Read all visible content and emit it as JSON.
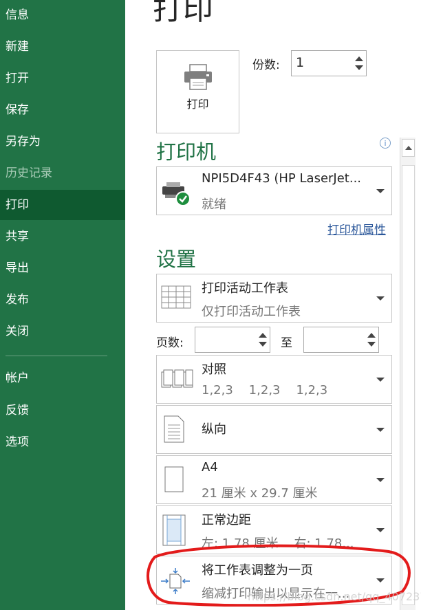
{
  "sidebar": {
    "items": [
      {
        "label": "信息"
      },
      {
        "label": "新建"
      },
      {
        "label": "打开"
      },
      {
        "label": "保存"
      },
      {
        "label": "另存为"
      },
      {
        "label": "历史记录"
      },
      {
        "label": "打印"
      },
      {
        "label": "共享"
      },
      {
        "label": "导出"
      },
      {
        "label": "发布"
      },
      {
        "label": "关闭"
      },
      {
        "label": "帐户"
      },
      {
        "label": "反馈"
      },
      {
        "label": "选项"
      }
    ],
    "active": "打印",
    "disabled": "历史记录"
  },
  "main": {
    "title": "打印",
    "print_button": {
      "label": "打印"
    },
    "copies": {
      "label": "份数:",
      "value": "1"
    },
    "printer_section": "打印机",
    "printer": {
      "name": "NPI5D4F43 (HP LaserJet...",
      "status": "就绪"
    },
    "printer_properties_link": "打印机属性",
    "settings_section": "设置",
    "settings": [
      {
        "title": "打印活动工作表",
        "subtitle": "仅打印活动工作表",
        "icon": "sheet-grid-icon"
      },
      {
        "title": "对照",
        "subtitle": "1,2,3    1,2,3    1,2,3",
        "icon": "collate-icon"
      },
      {
        "title": "纵向",
        "subtitle": "",
        "icon": "portrait-icon"
      },
      {
        "title": "A4",
        "subtitle": "21 厘米 x 29.7 厘米",
        "icon": "paper-size-icon"
      },
      {
        "title": "正常边距",
        "subtitle": "左: 1.78 厘米    右: 1.78...",
        "icon": "margins-icon"
      },
      {
        "title": "将工作表调整为一页",
        "subtitle": "缩减打印输出以显示在一...",
        "icon": "fit-page-icon"
      }
    ],
    "pages": {
      "label": "页数:",
      "to_label": "至",
      "from": "",
      "to": ""
    }
  },
  "colors": {
    "sidebar": "#217346",
    "active": "#0f5a30",
    "accent_text": "#217346",
    "link": "#2b579a",
    "annotation": "#e31b1b"
  },
  "watermark": "https://blog.csdn.net/qq_40723785"
}
